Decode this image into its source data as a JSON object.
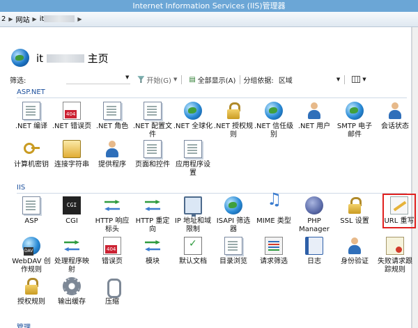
{
  "window": {
    "title": "Internet Information Services (IIS)管理器"
  },
  "breadcrumb": {
    "root": "2",
    "site_group": "网站",
    "site": "it"
  },
  "page": {
    "title_prefix": "it",
    "title_suffix": "主页"
  },
  "toolbar": {
    "filter_label": "筛选:",
    "start_label": "开始(G)",
    "show_all_label": "全部显示(A)",
    "group_by_label": "分组依据:",
    "group_by_value": "区域"
  },
  "groups": {
    "aspnet": {
      "title": "ASP.NET",
      "items": [
        {
          "label": ".NET 编译",
          "icon": "download-doc-icon"
        },
        {
          "label": ".NET 错误页",
          "icon": "error-page-icon"
        },
        {
          "label": ".NET 角色",
          "icon": "roles-icon"
        },
        {
          "label": ".NET 配置文件",
          "icon": "profile-doc-icon"
        },
        {
          "label": ".NET 全球化",
          "icon": "globe-icon"
        },
        {
          "label": ".NET 授权规则",
          "icon": "auth-lock-icon"
        },
        {
          "label": ".NET 信任级别",
          "icon": "trust-globe-icon"
        },
        {
          "label": ".NET 用户",
          "icon": "users-icon"
        },
        {
          "label": "SMTP 电子邮件",
          "icon": "mail-icon"
        },
        {
          "label": "会话状态",
          "icon": "session-icon"
        },
        {
          "label": "计算机密钥",
          "icon": "machine-key-icon"
        },
        {
          "label": "连接字符串",
          "icon": "connection-string-icon"
        },
        {
          "label": "提供程序",
          "icon": "provider-icon"
        },
        {
          "label": "页面和控件",
          "icon": "pages-controls-icon"
        },
        {
          "label": "应用程序设置",
          "icon": "app-settings-icon"
        }
      ]
    },
    "iis": {
      "title": "IIS",
      "items": [
        {
          "label": "ASP",
          "icon": "asp-icon"
        },
        {
          "label": "CGI",
          "icon": "cgi-icon"
        },
        {
          "label": "HTTP 响应标头",
          "icon": "http-headers-icon"
        },
        {
          "label": "HTTP 重定向",
          "icon": "http-redirect-icon"
        },
        {
          "label": "IP 地址和域限制",
          "icon": "ip-restrict-icon"
        },
        {
          "label": "ISAPI 筛选器",
          "icon": "isapi-icon"
        },
        {
          "label": "MIME 类型",
          "icon": "mime-icon"
        },
        {
          "label": "PHP Manager",
          "icon": "php-icon"
        },
        {
          "label": "SSL 设置",
          "icon": "ssl-lock-icon"
        },
        {
          "label": "URL 重写",
          "icon": "url-rewrite-icon"
        },
        {
          "label": "WebDAV 创作规则",
          "icon": "webdav-icon"
        },
        {
          "label": "处理程序映射",
          "icon": "handler-icon"
        },
        {
          "label": "错误页",
          "icon": "error-page-icon"
        },
        {
          "label": "模块",
          "icon": "modules-icon"
        },
        {
          "label": "默认文档",
          "icon": "default-doc-icon"
        },
        {
          "label": "目录浏览",
          "icon": "dir-browse-icon"
        },
        {
          "label": "请求筛选",
          "icon": "request-filter-icon"
        },
        {
          "label": "日志",
          "icon": "log-icon"
        },
        {
          "label": "身份验证",
          "icon": "authentication-icon"
        },
        {
          "label": "失败请求跟踪规则",
          "icon": "failed-trace-icon"
        },
        {
          "label": "授权规则",
          "icon": "authorization-icon"
        },
        {
          "label": "输出缓存",
          "icon": "output-cache-icon"
        },
        {
          "label": "压缩",
          "icon": "compression-icon"
        }
      ]
    },
    "management": {
      "title": "管理"
    }
  },
  "colors": {
    "titlebar": "#6ba6d6",
    "group_title": "#1a4e9c",
    "highlight": "#e0201e"
  }
}
